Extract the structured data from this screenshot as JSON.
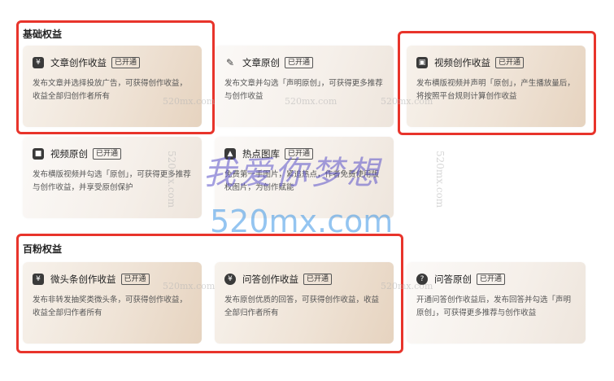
{
  "sections": {
    "basic_title": "基础权益",
    "fans_title": "百粉权益"
  },
  "badge_label": "已开通",
  "cards": {
    "article_income": {
      "icon": "yen-icon",
      "title": "文章创作收益",
      "desc": "发布文章并选择投放广告，可获得创作收益，收益全部归创作者所有"
    },
    "article_original": {
      "icon": "pen-icon",
      "title": "文章原创",
      "desc": "发布文章并勾选「声明原创」，可获得更多推荐与创作收益"
    },
    "video_income": {
      "icon": "tv-icon",
      "title": "视频创作收益",
      "desc": "发布横版视频并声明「原创」，产生播放量后，将按照平台规则计算创作收益"
    },
    "video_original": {
      "icon": "video-camera-icon",
      "title": "视频原创",
      "desc": "发布横版视频并勾选「原创」，可获得更多推荐与创作收益，并享受原创保护"
    },
    "hot_gallery": {
      "icon": "image-icon",
      "title": "热点图库",
      "desc": "免费第一手图片，紧追热点，作者免费使用版权图片，为创作赋能"
    },
    "micro_income": {
      "icon": "yen-icon",
      "title": "微头条创作收益",
      "desc": "发布非转发抽奖类微头条，可获得创作收益，收益全部归作者所有"
    },
    "qa_income": {
      "icon": "yen-circle-icon",
      "title": "问答创作收益",
      "desc": "发布原创优质的回答，可获得创作收益，收益全部归作者所有"
    },
    "qa_original": {
      "icon": "question-circle-icon",
      "title": "问答原创",
      "desc": "开通问答创作收益后，发布回答并勾选「声明原创」，可获得更多推荐与创作收益"
    }
  },
  "watermarks": {
    "small": "520mx.com",
    "big_cn": "我爱你梦想",
    "big_en": "520mx.com"
  },
  "colors": {
    "highlight_border": "#e8342b",
    "card_gradient_start": "#f7f2ec",
    "card_gradient_end": "#e6d3bf"
  }
}
